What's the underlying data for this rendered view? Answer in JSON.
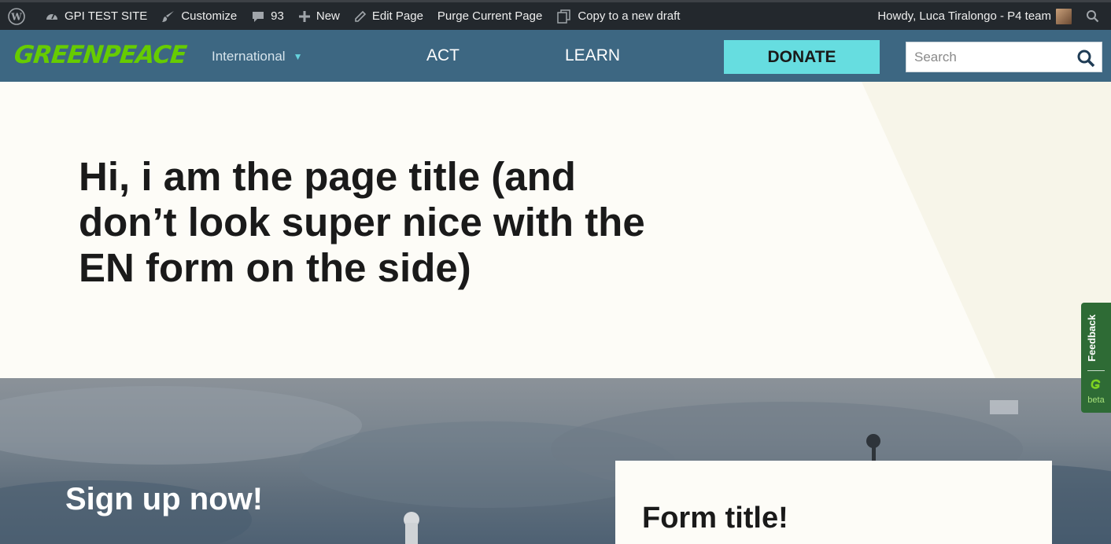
{
  "adminbar": {
    "items": [
      {
        "label": "GPI TEST SITE",
        "icon": "dashboard-icon"
      },
      {
        "label": "Customize",
        "icon": "brush-icon"
      },
      {
        "label": "93",
        "icon": "comment-icon"
      },
      {
        "label": "New",
        "icon": "plus-icon"
      },
      {
        "label": "Edit Page",
        "icon": "pencil-icon"
      },
      {
        "label": "Purge Current Page"
      },
      {
        "label": "Copy to a new draft",
        "icon": "copy-icon"
      }
    ],
    "greeting": "Howdy, Luca Tiralongo - P4 team"
  },
  "header": {
    "logo": "GREENPEACE",
    "country": "International",
    "nav": {
      "act": "ACT",
      "learn": "LEARN"
    },
    "donate": "DONATE",
    "search_placeholder": "Search"
  },
  "hero": {
    "title": "Hi, i am the page title (and don’t look super nice with the EN form on the side)"
  },
  "signup": {
    "heading": "Sign up now!",
    "form_title": "Form title!"
  },
  "feedback": {
    "label": "Feedback",
    "beta": "beta"
  },
  "colors": {
    "admin_bar": "#23282d",
    "header": "#3d6782",
    "logo_green": "#66cc00",
    "donate": "#66dde0",
    "hero_bg": "#fdfcf7",
    "feedback": "#2e6b35"
  }
}
